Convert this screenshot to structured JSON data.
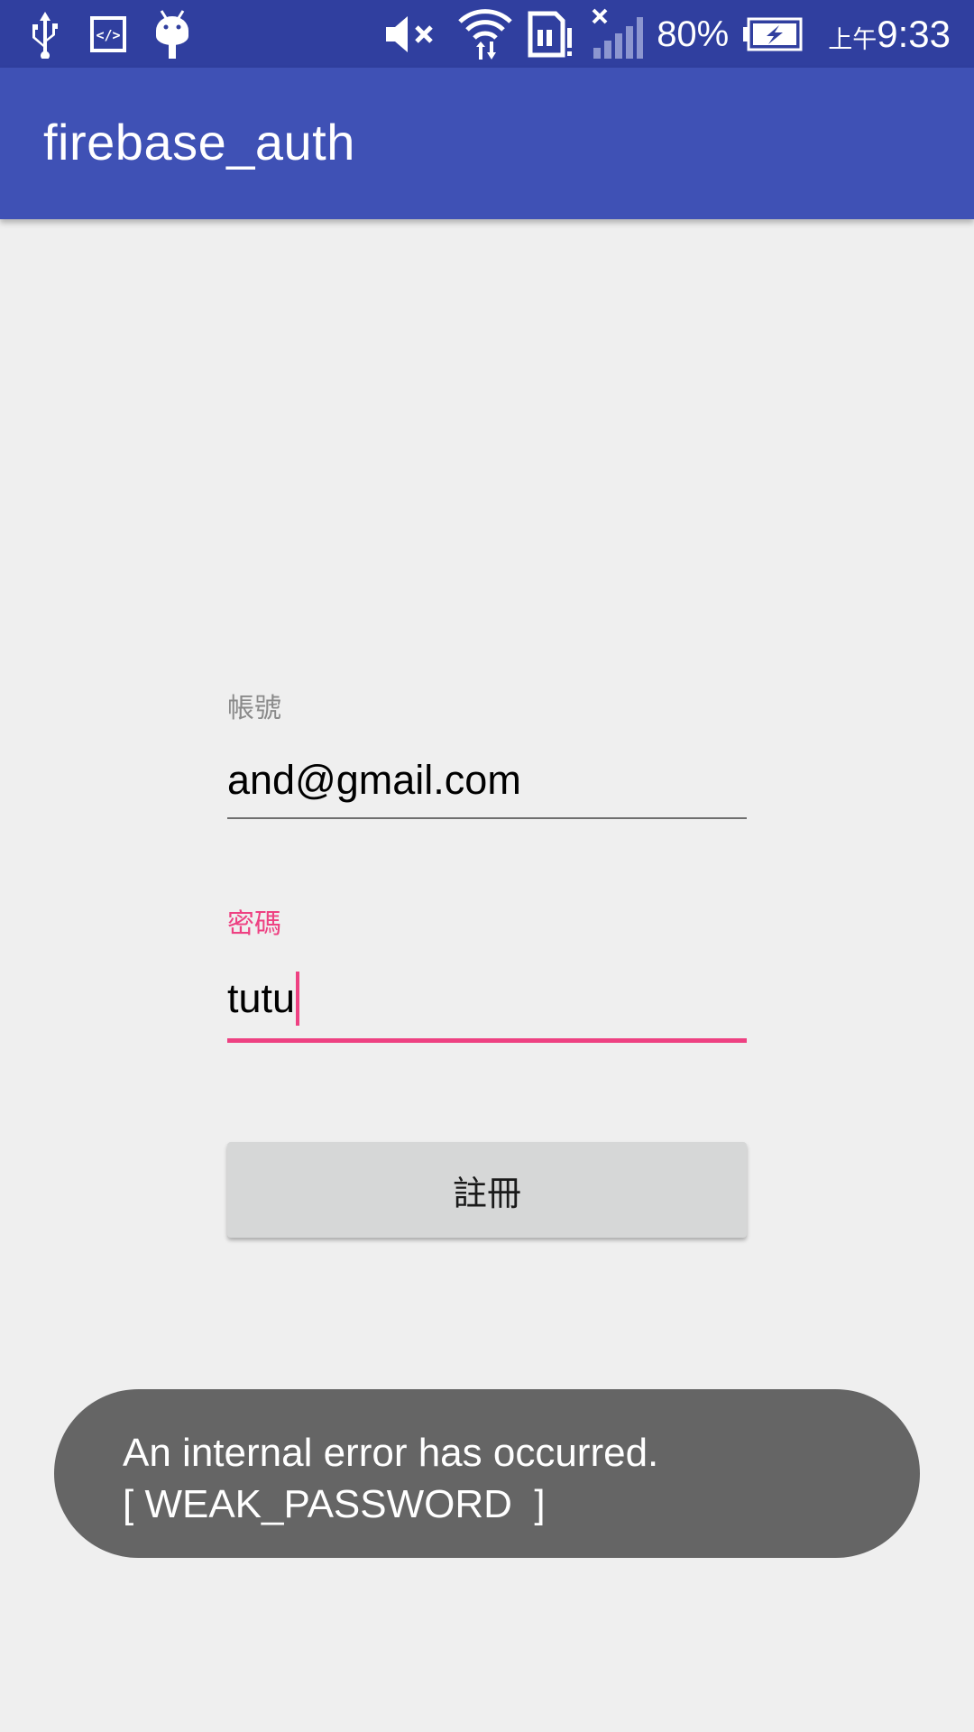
{
  "status_bar": {
    "battery_percent": "80%",
    "clock_prefix": "上午",
    "clock_time": "9:33",
    "icons_left": [
      "usb-icon",
      "developer-code-icon",
      "android-debug-icon"
    ],
    "icons_right": [
      "muted-volume-icon",
      "wifi-icon",
      "sim-alert-icon",
      "no-signal-icon",
      "battery-charging-icon"
    ]
  },
  "app_bar": {
    "title": "firebase_auth",
    "background": "#3f51b5"
  },
  "form": {
    "account": {
      "label": "帳號",
      "value": "and@gmail.com"
    },
    "password": {
      "label": "密碼",
      "value": "tutu",
      "accent": "#ee4182"
    },
    "register_button_label": "註冊"
  },
  "toast": {
    "line1": "An internal error has occurred.",
    "line2": "[ WEAK_PASSWORD  ]"
  }
}
